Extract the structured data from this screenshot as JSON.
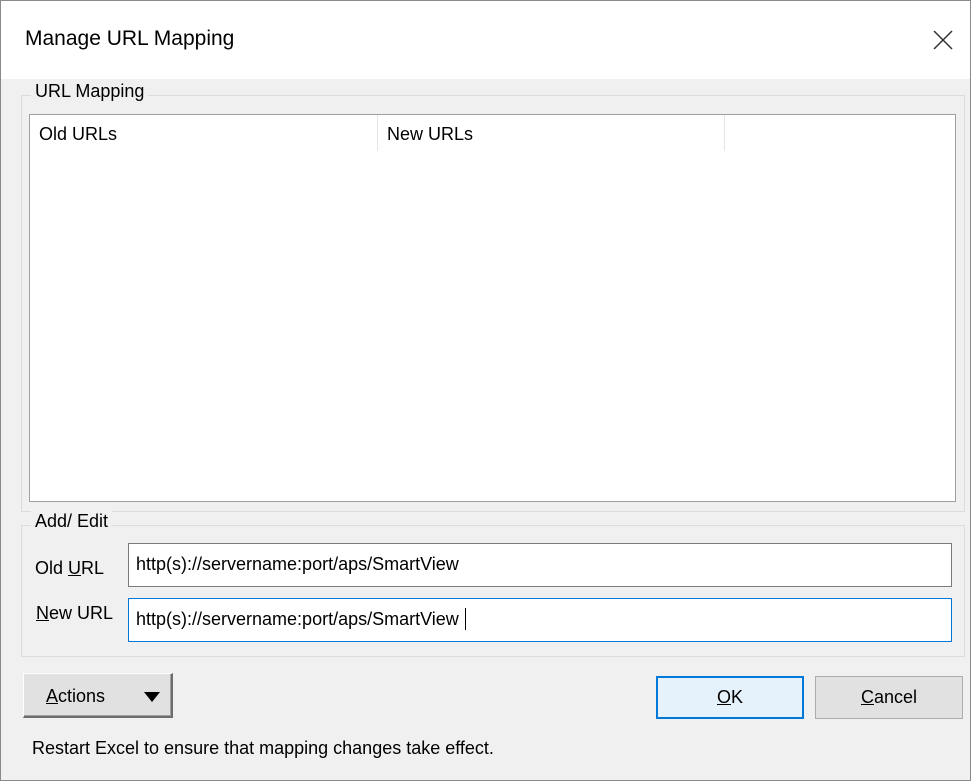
{
  "window": {
    "title": "Manage URL Mapping"
  },
  "mapping_group": {
    "label": "URL Mapping",
    "columns": [
      "Old URLs",
      "New URLs",
      ""
    ],
    "rows": []
  },
  "edit_group": {
    "label": "Add/ Edit",
    "old_url_label_pre": "Old ",
    "old_url_label_accel": "U",
    "old_url_label_post": "RL",
    "old_url_value": "http(s)://servername:port/aps/SmartView",
    "new_url_label_pre": "",
    "new_url_label_accel": "N",
    "new_url_label_post": "ew URL",
    "new_url_value": "http(s)://servername:port/aps/SmartView"
  },
  "buttons": {
    "actions_accel": "A",
    "actions_rest": "ctions",
    "ok_accel": "O",
    "ok_rest": "K",
    "cancel_accel": "C",
    "cancel_rest": "ancel"
  },
  "status_text": "Restart Excel to ensure that mapping changes take effect.",
  "icons": {
    "close": "close-icon",
    "dropdown": "caret-down-icon"
  }
}
